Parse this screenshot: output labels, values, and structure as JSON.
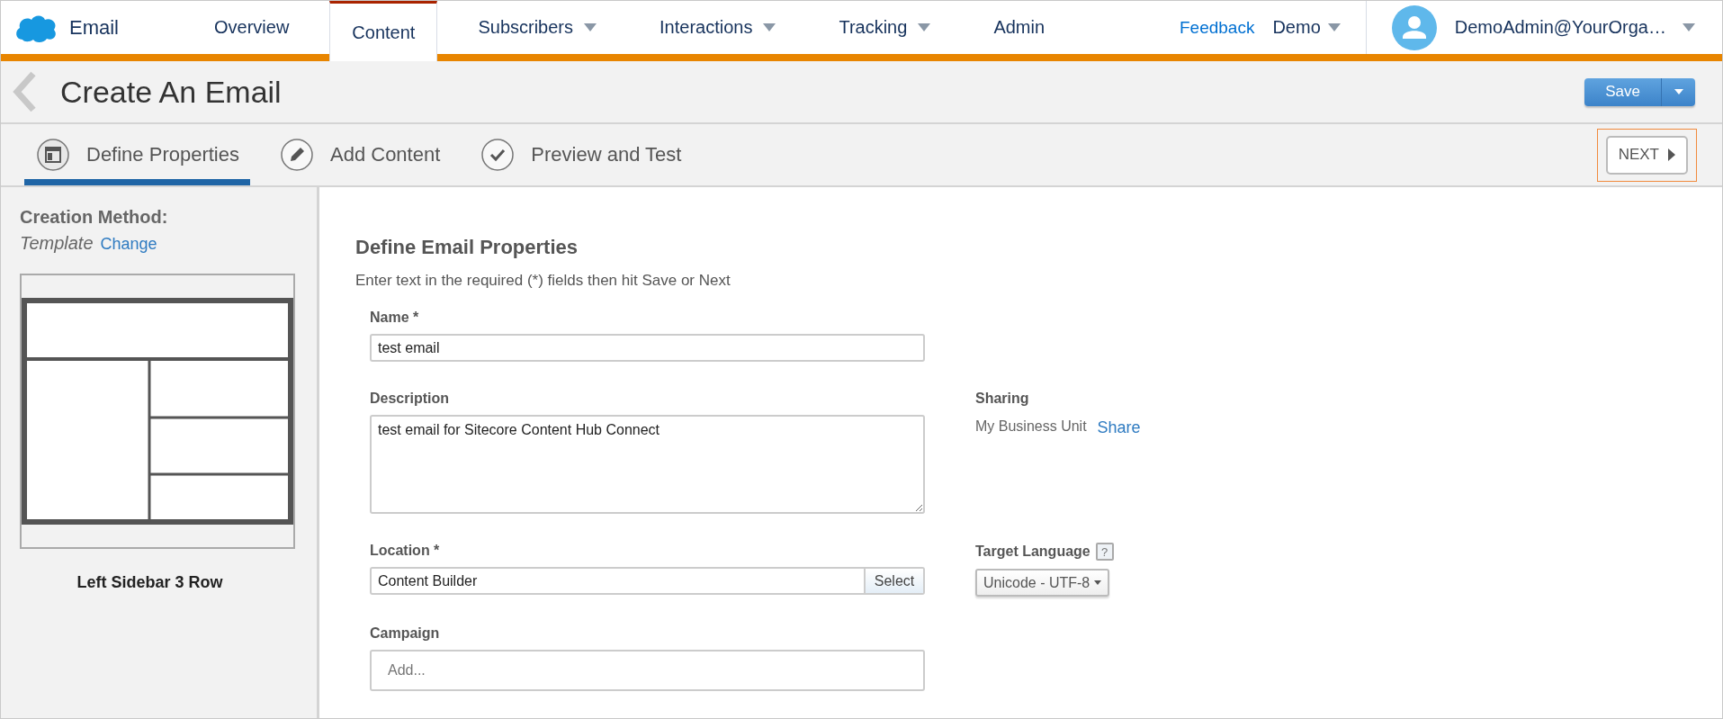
{
  "app": {
    "name": "Email"
  },
  "nav": [
    {
      "label": "Overview",
      "selected": false,
      "has_menu": false
    },
    {
      "label": "Content",
      "selected": true,
      "has_menu": false
    },
    {
      "label": "Subscribers",
      "selected": false,
      "has_menu": true
    },
    {
      "label": "Interactions",
      "selected": false,
      "has_menu": true
    },
    {
      "label": "Tracking",
      "selected": false,
      "has_menu": true
    },
    {
      "label": "Admin",
      "selected": false,
      "has_menu": false
    }
  ],
  "feedback_link": "Feedback",
  "account_menu": {
    "label": "Demo"
  },
  "user_menu": {
    "label": "DemoAdmin@YourOrga…"
  },
  "page": {
    "title": "Create An Email",
    "save_button": "Save"
  },
  "steps": [
    {
      "label": "Define Properties",
      "selected": true,
      "kind": "layout"
    },
    {
      "label": "Add Content",
      "selected": false,
      "kind": "pencil"
    },
    {
      "label": "Preview and Test",
      "selected": false,
      "kind": "check"
    }
  ],
  "next_button": "NEXT",
  "sidebar": {
    "heading": "Creation Method:",
    "method": "Template",
    "change_link": "Change",
    "template_name": "Left Sidebar 3 Row"
  },
  "form": {
    "title": "Define Email Properties",
    "hint": "Enter text in the required (*) fields then hit Save or Next",
    "name": {
      "label": "Name *",
      "value": "test email"
    },
    "description": {
      "label": "Description",
      "value": "test email for Sitecore Content Hub Connect"
    },
    "location": {
      "label": "Location *",
      "value": "Content Builder",
      "button": "Select"
    },
    "campaign": {
      "label": "Campaign",
      "placeholder": "Add..."
    },
    "sharing": {
      "label": "Sharing",
      "value": "My Business Unit",
      "link": "Share"
    },
    "target_language": {
      "label": "Target Language",
      "help": "?",
      "value": "Unicode - UTF-8"
    }
  }
}
